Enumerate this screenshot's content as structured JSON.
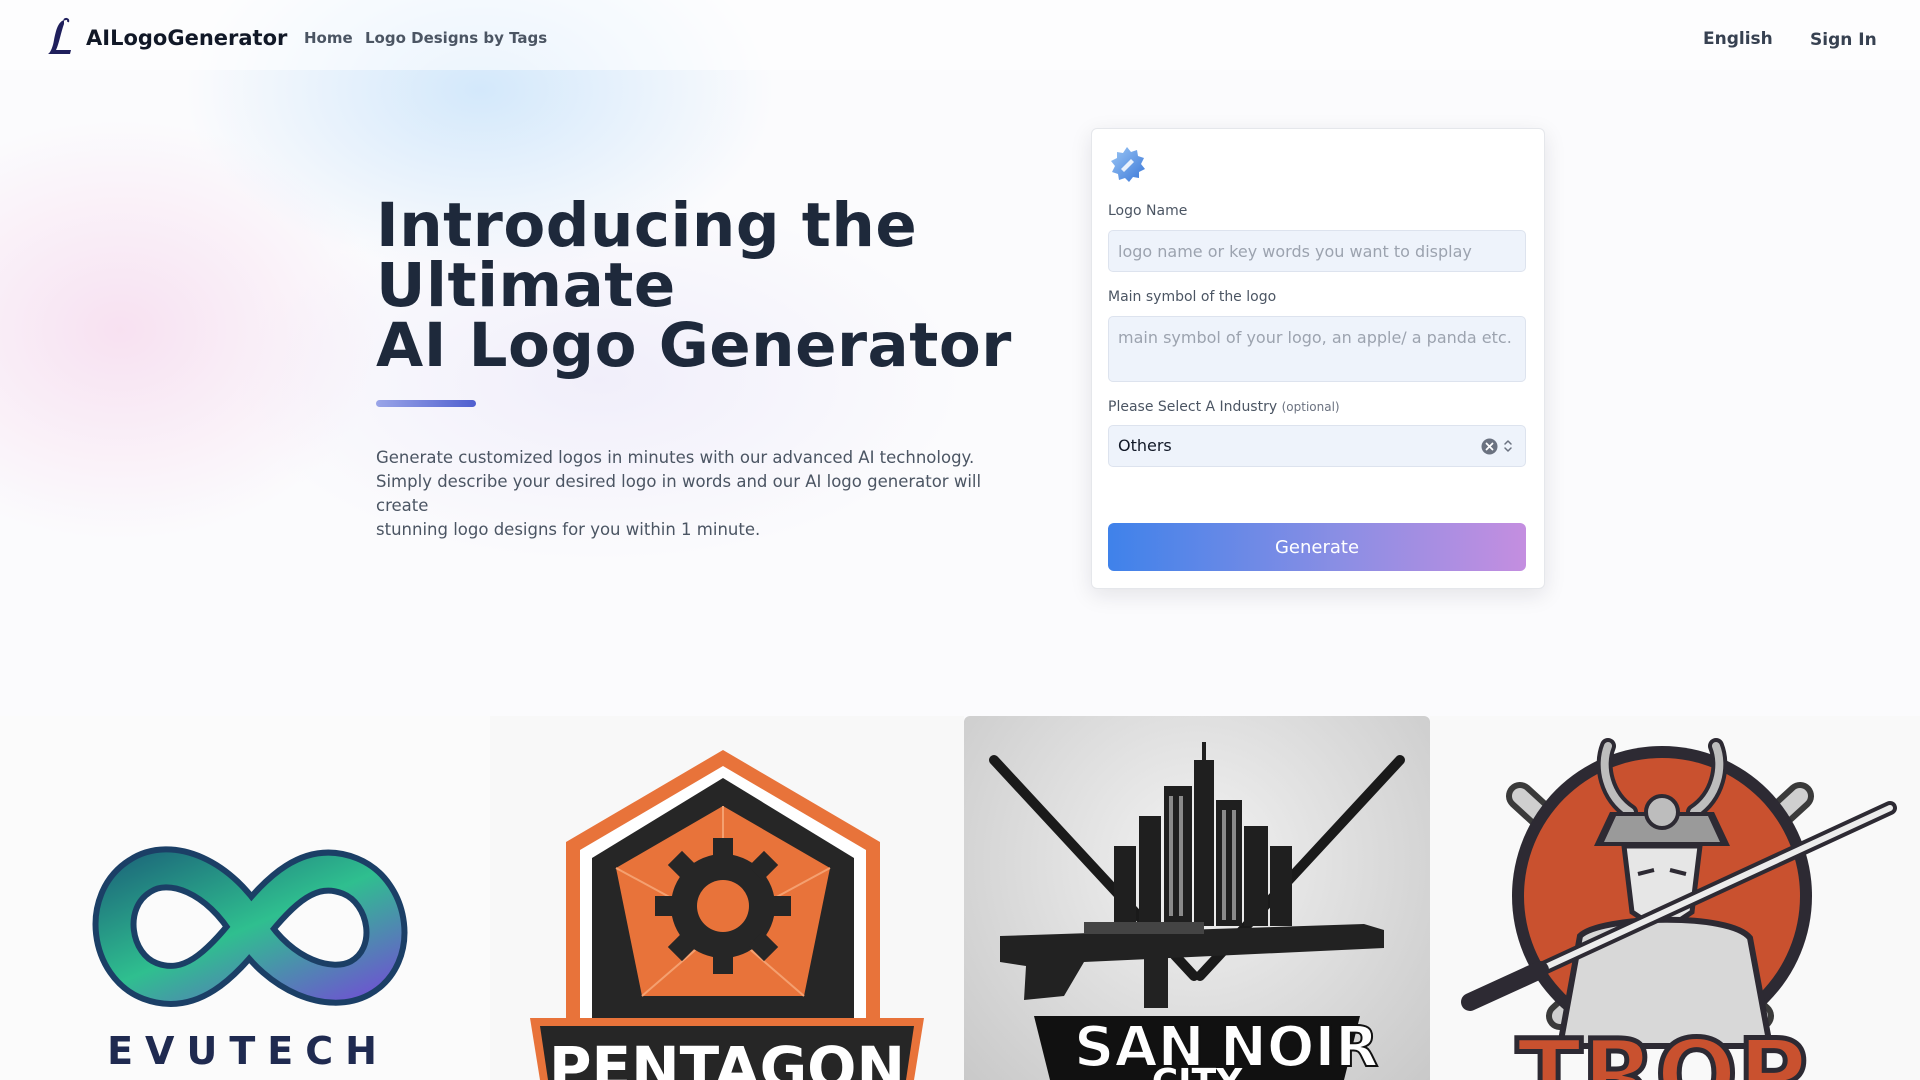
{
  "header": {
    "brand": "AILogoGenerator",
    "nav": [
      "Home",
      "Logo Designs by Tags"
    ],
    "language": "English",
    "sign_in": "Sign In"
  },
  "hero": {
    "title_lines": [
      "Introducing the",
      "Ultimate",
      "AI Logo Generator"
    ],
    "description_lines": [
      "Generate customized logos in minutes with our advanced AI technology.",
      "Simply describe your desired logo in words and our AI logo generator will create",
      "stunning logo designs for you within 1 minute."
    ]
  },
  "form": {
    "logo_name_label": "Logo Name",
    "logo_name_placeholder": "logo name or key words you want to display",
    "logo_name_value": "",
    "symbol_label": "Main symbol of the logo",
    "symbol_placeholder": "main symbol of your logo, an apple/ a panda etc.",
    "symbol_value": "",
    "industry_label": "Please Select A Industry",
    "industry_optional": "(optional)",
    "industry_value": "Others",
    "generate_label": "Generate"
  },
  "gallery": {
    "logos": [
      {
        "text": "EVUTECH",
        "icon": "infinity-icon"
      },
      {
        "text": "PENTAGON",
        "icon": "gear-pentagon-icon"
      },
      {
        "text_lines": [
          "SAN",
          "NOIR",
          "CITY"
        ],
        "icon": "city-rifle-icon"
      },
      {
        "text": "TROP",
        "icon": "samurai-icon"
      }
    ]
  },
  "colors": {
    "title": "#1e293b",
    "accent_gradient_start": "#3f82ea",
    "accent_gradient_end": "#c48ee0",
    "pentagon_orange": "#e8733a",
    "samurai_red": "#c9512f"
  }
}
